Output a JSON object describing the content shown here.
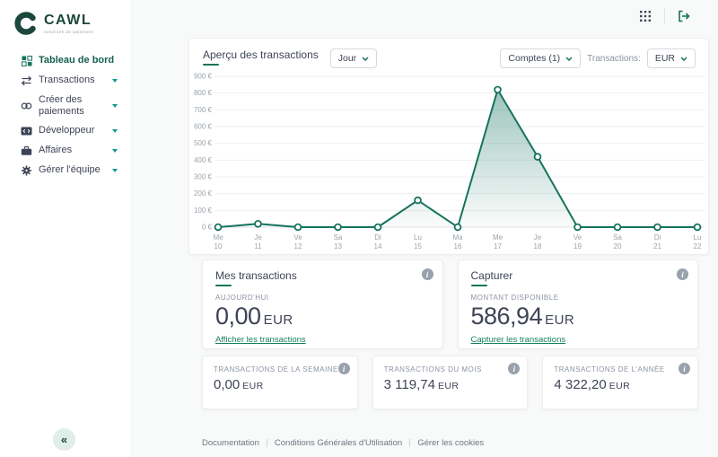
{
  "brand": {
    "name": "CAWL",
    "tagline": "solutions de paiement"
  },
  "topbar": {
    "icons": [
      "apps-grid-icon",
      "logout-icon"
    ]
  },
  "sidebar": {
    "items": [
      {
        "label": "Tableau de bord",
        "icon": "dashboard-icon",
        "active": true,
        "has_submenu": false
      },
      {
        "label": "Transactions",
        "icon": "transfer-icon",
        "active": false,
        "has_submenu": true
      },
      {
        "label": "Créer des paiements",
        "icon": "link-icon",
        "active": false,
        "has_submenu": true
      },
      {
        "label": "Développeur",
        "icon": "code-icon",
        "active": false,
        "has_submenu": true
      },
      {
        "label": "Affaires",
        "icon": "briefcase-icon",
        "active": false,
        "has_submenu": true
      },
      {
        "label": "Gérer l'équipe",
        "icon": "gear-icon",
        "active": false,
        "has_submenu": true
      }
    ],
    "collapse_glyph": "«"
  },
  "chart_header": {
    "title": "Aperçu des transactions",
    "period_select": "Jour",
    "accounts_select": "Comptes (1)",
    "transactions_label": "Transactions:",
    "currency_select": "EUR"
  },
  "chart_data": {
    "type": "area",
    "title": "Aperçu des transactions",
    "x": [
      "Me 10",
      "Je 11",
      "Ve 12",
      "Sa 13",
      "Di 14",
      "Lu 15",
      "Ma 16",
      "Me 17",
      "Je 18",
      "Ve 19",
      "Sa 20",
      "Di 21",
      "Lu 22"
    ],
    "values": [
      0,
      20,
      0,
      0,
      0,
      160,
      0,
      820,
      420,
      0,
      0,
      0,
      0
    ],
    "ylim": [
      0,
      900
    ],
    "y_tick_step": 100,
    "y_tick_suffix": " €",
    "grid": true,
    "legend": "none",
    "line_color": "#15735c",
    "point_style": "open-circle"
  },
  "summary_cards": [
    {
      "title": "Mes transactions",
      "label": "AUJOURD'HUI",
      "amount": "0,00",
      "currency": "EUR",
      "link": "Afficher les transactions"
    },
    {
      "title": "Capturer",
      "label": "MONTANT DISPONIBLE",
      "amount": "586,94",
      "currency": "EUR",
      "link": "Capturer les transactions"
    }
  ],
  "stat_cards": [
    {
      "label": "TRANSACTIONS DE LA SEMAINE",
      "amount": "0,00",
      "currency": "EUR"
    },
    {
      "label": "TRANSACTIONS DU MOIS",
      "amount": "3 119,74",
      "currency": "EUR"
    },
    {
      "label": "TRANSACTIONS DE L'ANNÉE",
      "amount": "4 322,20",
      "currency": "EUR"
    }
  ],
  "footer": {
    "links": [
      "Documentation",
      "Conditions Générales d'Utilisation",
      "Gérer les cookies"
    ]
  },
  "icons": {
    "info_glyph": "i"
  },
  "colors": {
    "primary_green": "#15735c",
    "logo_green": "#1c473c",
    "text_dark": "#3e4456",
    "text_gray": "#8c95a3",
    "axis_gray": "#9aa3ab",
    "main_bg": "#f8f9f9",
    "card_bg": "#ffffff"
  }
}
